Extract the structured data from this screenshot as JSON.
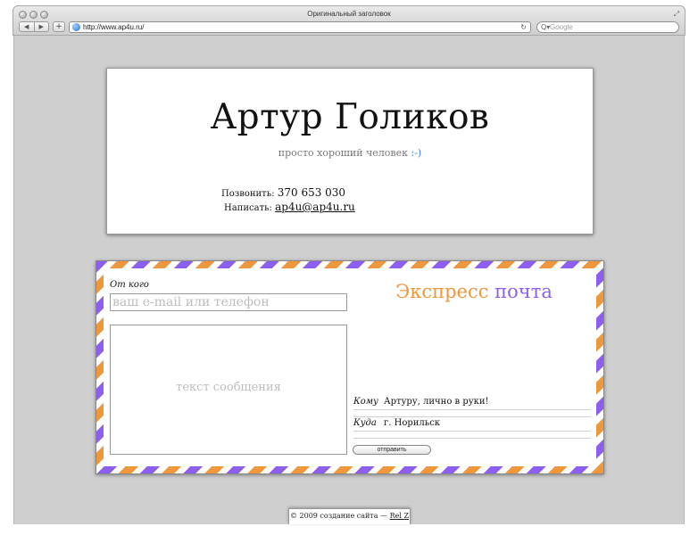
{
  "browser": {
    "title": "Оригинальный заголовок",
    "url": "http://www.ap4u.ru/",
    "search_placeholder": "Google",
    "back_glyph": "◀",
    "forward_glyph": "▶",
    "add_glyph": "+",
    "reload_glyph": "↻",
    "search_glyph": "Q▾",
    "resize_glyph": "⤢"
  },
  "header": {
    "name": "Артур Голиков",
    "tagline": "просто хороший человек",
    "smiley": ":-)",
    "call_label": "Позвонить:",
    "phone": "370 653 030",
    "write_label": "Написать:",
    "email": "ap4u@ap4u.ru"
  },
  "envelope": {
    "from_label": "От кого",
    "from_placeholder": "ваш e-mail или телефон",
    "message_placeholder": "текст сообщения",
    "headline_part1": "Экспресс",
    "headline_part2": "почта",
    "to_label": "Кому",
    "to_value": "Артуру, лично в руки!",
    "where_label": "Куда",
    "where_value": "г. Норильск",
    "send_label": "отправить"
  },
  "footer": {
    "text": "© 2009 создание сайта —",
    "link": "Rel Z"
  },
  "colors": {
    "accent_orange": "#f0973c",
    "accent_purple": "#8c5ff0",
    "background": "#cfcfcf"
  }
}
